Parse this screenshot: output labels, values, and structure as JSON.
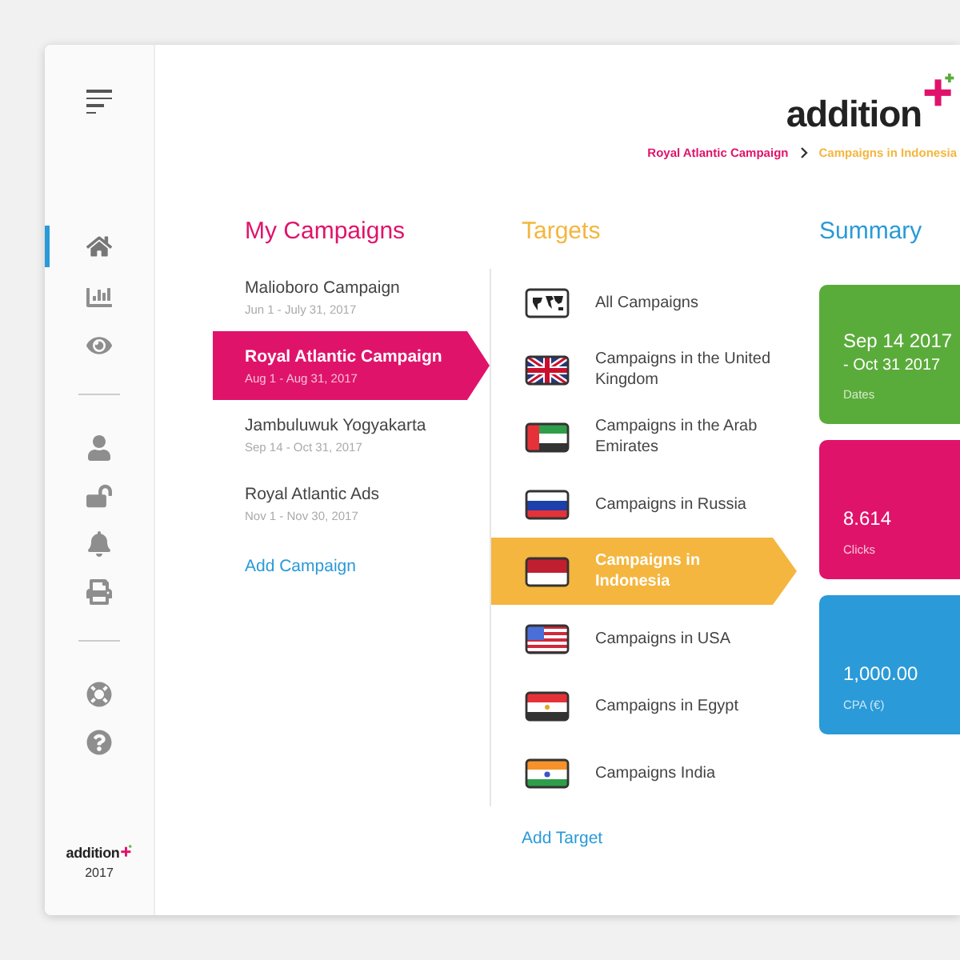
{
  "sidebar": {
    "groups": [
      [
        {
          "kind": "home",
          "selected": true
        },
        {
          "kind": "chart",
          "selected": false
        },
        {
          "kind": "eye",
          "selected": false
        }
      ],
      [
        {
          "kind": "user",
          "selected": false
        },
        {
          "kind": "lock",
          "selected": false
        },
        {
          "kind": "bell",
          "selected": false
        },
        {
          "kind": "printer",
          "selected": false
        }
      ],
      [
        {
          "kind": "lifebuoy",
          "selected": false
        },
        {
          "kind": "help",
          "selected": false
        }
      ]
    ],
    "logo": "addition",
    "year": "2017"
  },
  "header": {
    "logo": "addition",
    "breadcrumb": [
      "Royal Atlantic Campaign",
      "Campaigns in Indonesia"
    ]
  },
  "campaigns": {
    "title": "My Campaigns",
    "items": [
      {
        "name": "Malioboro Campaign",
        "dates": "Jun 1 - July 31, 2017",
        "selected": false
      },
      {
        "name": "Royal Atlantic Campaign",
        "dates": "Aug 1 - Aug 31, 2017",
        "selected": true
      },
      {
        "name": "Jambuluwuk Yogyakarta",
        "dates": "Sep 14 - Oct 31, 2017",
        "selected": false
      },
      {
        "name": "Royal Atlantic Ads",
        "dates": "Nov 1 - Nov 30, 2017",
        "selected": false
      }
    ],
    "add": "Add Campaign"
  },
  "targets": {
    "title": "Targets",
    "items": [
      {
        "label": "All Campaigns",
        "kind": "world",
        "selected": false
      },
      {
        "label": "Campaigns in the United Kingdom",
        "kind": "uk",
        "selected": false
      },
      {
        "label": "Campaigns in the Arab Emirates",
        "kind": "uae",
        "selected": false
      },
      {
        "label": "Campaigns in Russia",
        "kind": "russia",
        "selected": false
      },
      {
        "label": "Campaigns in Indonesia",
        "kind": "indonesia",
        "selected": true
      },
      {
        "label": "Campaigns in USA",
        "kind": "usa",
        "selected": false
      },
      {
        "label": "Campaigns in Egypt",
        "kind": "egypt",
        "selected": false
      },
      {
        "label": "Campaigns India",
        "kind": "india",
        "selected": false
      }
    ],
    "add": "Add Target"
  },
  "summary": {
    "title": "Summary",
    "cards": [
      {
        "value": "Sep 14 2017",
        "value_2": "- Oct 31 2017",
        "label": "Dates",
        "color": "#5aac3a"
      },
      {
        "value": "8.614",
        "label": "Clicks",
        "color": "#e0136b"
      },
      {
        "value": "1,000.00",
        "label": "CPA (€)",
        "color": "#2a9ad8"
      }
    ]
  }
}
